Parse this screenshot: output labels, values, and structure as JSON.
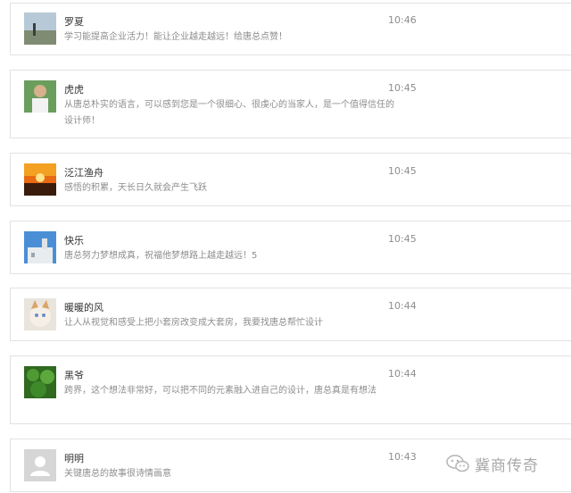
{
  "comments": [
    {
      "avatar": "landscape-avatar",
      "name": "罗夏",
      "time": "10:46",
      "text": "学习能提高企业活力！能让企业越走越远！给唐总点赞！"
    },
    {
      "avatar": "person-avatar",
      "name": "虎虎",
      "time": "10:45",
      "text": "从唐总朴实的语言，可以感到您是一个很细心、很虔心的当家人，是一个值得信任的设计师！"
    },
    {
      "avatar": "sunset-avatar",
      "name": "泛江渔舟",
      "time": "10:45",
      "text": "感悟的积累，天长日久就会产生飞跃"
    },
    {
      "avatar": "town-avatar",
      "name": "快乐",
      "time": "10:45",
      "text": "唐总努力梦想成真，祝福他梦想路上越走越远！5"
    },
    {
      "avatar": "kitten-avatar",
      "name": "暖暖的风",
      "time": "10:44",
      "text": "让人从视觉和感受上把小套房改变成大套房，我要找唐总帮忙设计"
    },
    {
      "avatar": "plant-avatar",
      "name": "黑爷",
      "time": "10:44",
      "text": "跨界，这个想法非常好，可以把不同的元素融入进自己的设计，唐总真是有想法"
    },
    {
      "avatar": "default-user-avatar",
      "name": "明明",
      "time": "10:43",
      "text": "关键唐总的故事很诗情画意"
    }
  ],
  "watermark": {
    "icon": "wechat-icon",
    "text": "冀商传奇"
  }
}
